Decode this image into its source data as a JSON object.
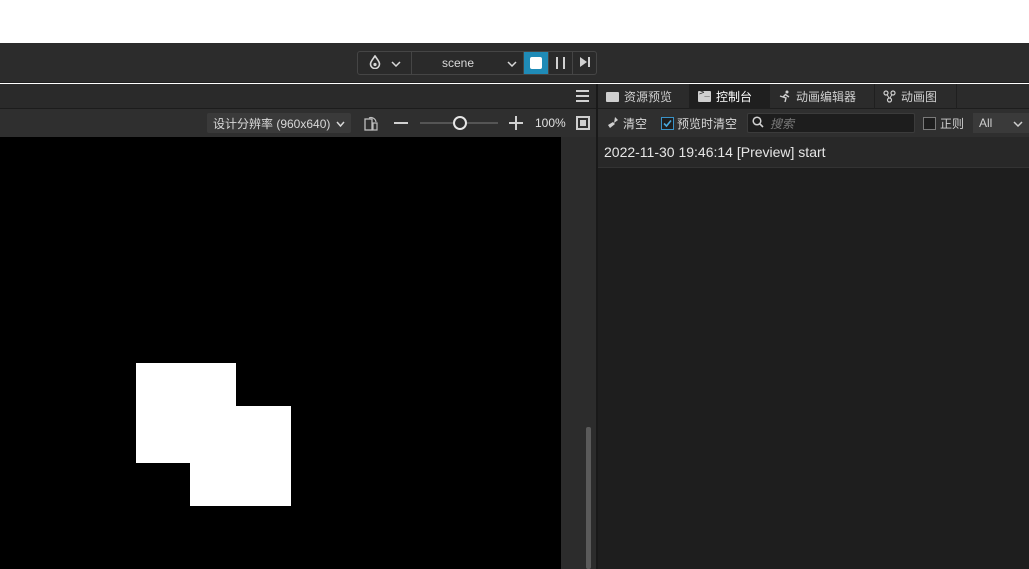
{
  "toolbar": {
    "scene_select": "scene",
    "platform_icon": "drop-icon",
    "controls": [
      "stop-icon",
      "pause-icon",
      "step-icon"
    ],
    "play_color": "#1f8bb7"
  },
  "scene": {
    "resolution_label": "设计分辨率 (960x640)",
    "zoom_value": "100%",
    "zoom_level": 0.5
  },
  "panel": {
    "tabs": [
      {
        "label": "资源预览",
        "icon": "folder-icon"
      },
      {
        "label": "控制台",
        "icon": "terminal-icon",
        "active": true
      },
      {
        "label": "动画编辑器",
        "icon": "run-icon"
      },
      {
        "label": "动画图",
        "icon": "graph-icon"
      }
    ]
  },
  "console": {
    "clear_label": "清空",
    "preview_clear_label": "预览时清空",
    "preview_clear_checked": true,
    "search_placeholder": "搜索",
    "regex_label": "正则",
    "filter_value": "All",
    "logs": [
      "2022-11-30 19:46:14 [Preview] start"
    ]
  }
}
